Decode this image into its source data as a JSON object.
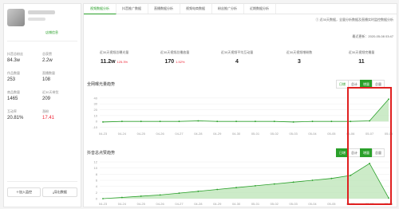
{
  "profile": {
    "link": "店铺信息"
  },
  "stats": [
    {
      "label": "抖音总粉丝",
      "value": "84.3w",
      "red": false
    },
    {
      "label": "总获赞",
      "value": "2.2w",
      "red": false
    },
    {
      "label": "作品数量",
      "value": "253",
      "red": false
    },
    {
      "label": "直播数量",
      "value": "108",
      "red": false
    },
    {
      "label": "商品数量",
      "value": "1465",
      "red": false
    },
    {
      "label": "近30天带货",
      "value": "209",
      "red": false
    },
    {
      "label": "互动率",
      "value": "20.81%",
      "red": false
    },
    {
      "label": "涨粉",
      "value": "17.41",
      "red": true
    }
  ],
  "left_buttons": {
    "add": "加入监控",
    "export": "导出数据"
  },
  "tabs": [
    "视频数据分析",
    "抖音推广数据",
    "直播数据分析",
    "视频电商数据",
    "粉丝推广分析",
    "近期数据分析"
  ],
  "notes": {
    "top": "① 近30天数据，全量分析数据及直播实时监控数据分析",
    "update": "最近更新：2020-05-08 03:47"
  },
  "metrics": [
    {
      "title": "近30天视频总曝光量",
      "value": "11.2w",
      "change": "125.3%"
    },
    {
      "title": "近30天视频总播放量",
      "value": "170",
      "change": "1.52%"
    },
    {
      "title": "近30天视频平均互动量",
      "value": "4",
      "change": ""
    },
    {
      "title": "近30天视频增粉数",
      "value": "3",
      "change": ""
    },
    {
      "title": "近30天视频完播量",
      "value": "11",
      "change": ""
    }
  ],
  "section1": {
    "title": "全网曝光量趋势",
    "buttons": [
      "日增",
      "总计",
      "增量",
      "总量"
    ]
  },
  "section2": {
    "title": "抖音总点赞趋势",
    "buttons": [
      "日增",
      "总计",
      "增量",
      "总量"
    ]
  },
  "chart_data": [
    {
      "type": "area",
      "title": "全网曝光量趋势",
      "categories": [
        "04-23",
        "04-24",
        "04-25",
        "04-26",
        "04-27",
        "04-28",
        "04-29",
        "04-30",
        "05-01",
        "05-02",
        "05-03",
        "05-04",
        "05-05",
        "05-06",
        "05-07",
        "05-08"
      ],
      "ylim": [
        -12,
        48
      ],
      "yticks": [
        -10,
        0,
        10,
        20,
        30,
        40
      ],
      "series": [
        {
          "values": [
            -1,
            0,
            0,
            0,
            0,
            1,
            0,
            0,
            0,
            0,
            -1,
            0,
            0,
            0,
            1,
            38
          ]
        }
      ]
    },
    {
      "type": "area",
      "title": "抖音总点赞趋势",
      "categories": [
        "04-23",
        "04-24",
        "04-25",
        "04-26",
        "04-27",
        "04-28",
        "04-29",
        "04-30",
        "05-01",
        "05-02",
        "05-03",
        "05-04",
        "05-05",
        "05-06",
        "05-07",
        "05-08"
      ],
      "ylim": [
        0,
        12
      ],
      "yticks": [
        "0",
        "2",
        "4",
        "6",
        "8",
        "10",
        "12"
      ],
      "series": [
        {
          "values": [
            0,
            0.4,
            0.8,
            1.2,
            1.8,
            2.4,
            3,
            3.6,
            4.2,
            4.8,
            5.4,
            6,
            6.6,
            7.6,
            11.5,
            0.2
          ]
        }
      ]
    }
  ],
  "colors": {
    "accent": "#2aa02a",
    "highlight": "#e02020",
    "area": "#b7e3b0"
  }
}
